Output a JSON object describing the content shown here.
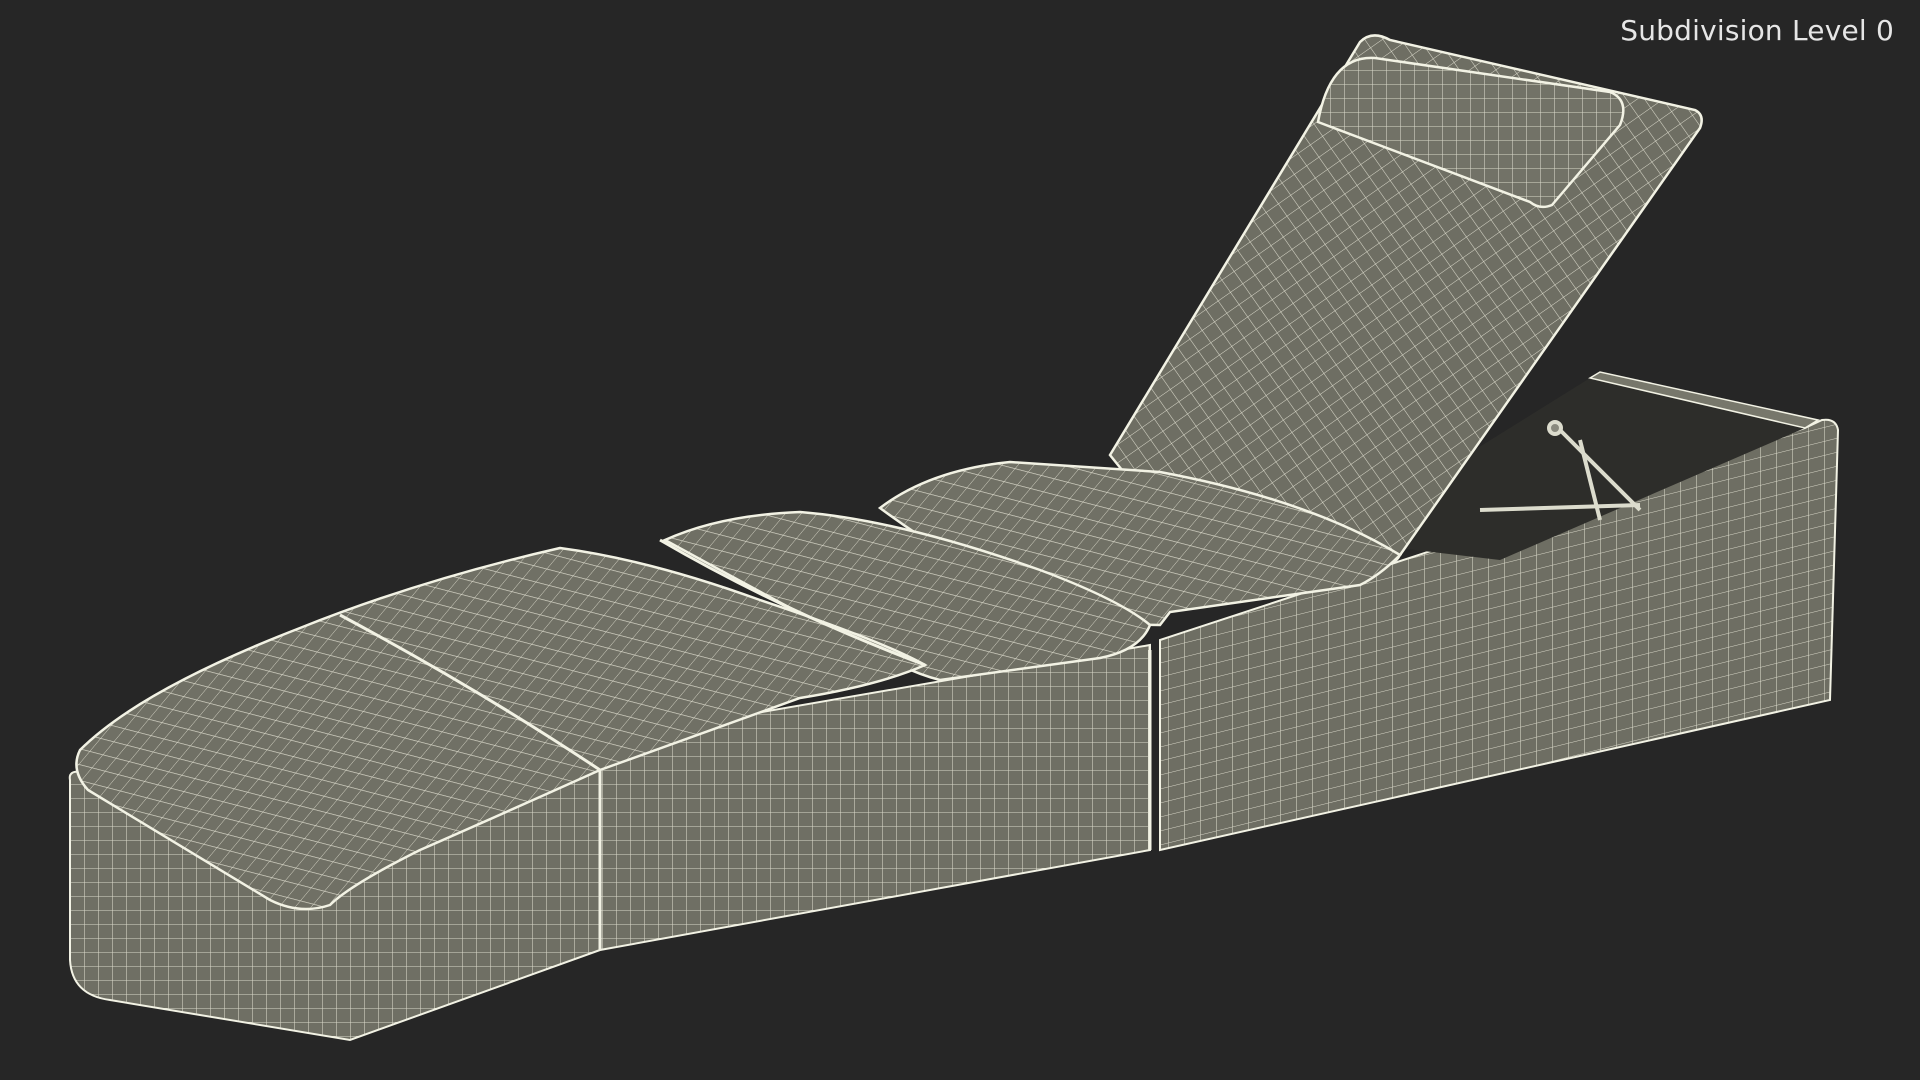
{
  "viewport": {
    "subdivision_label": "Subdivision Level 0",
    "background_color": "#262626",
    "mesh_fill_color": "#6f6f64",
    "wire_color": "#eeeede"
  },
  "model": {
    "object": "chaise-lounge",
    "parts": [
      "base-front",
      "base-rear",
      "seat-cushion-front",
      "seat-cushion-middle",
      "seat-cushion-rear",
      "backrest",
      "head-pillow",
      "recline-mechanism"
    ]
  }
}
